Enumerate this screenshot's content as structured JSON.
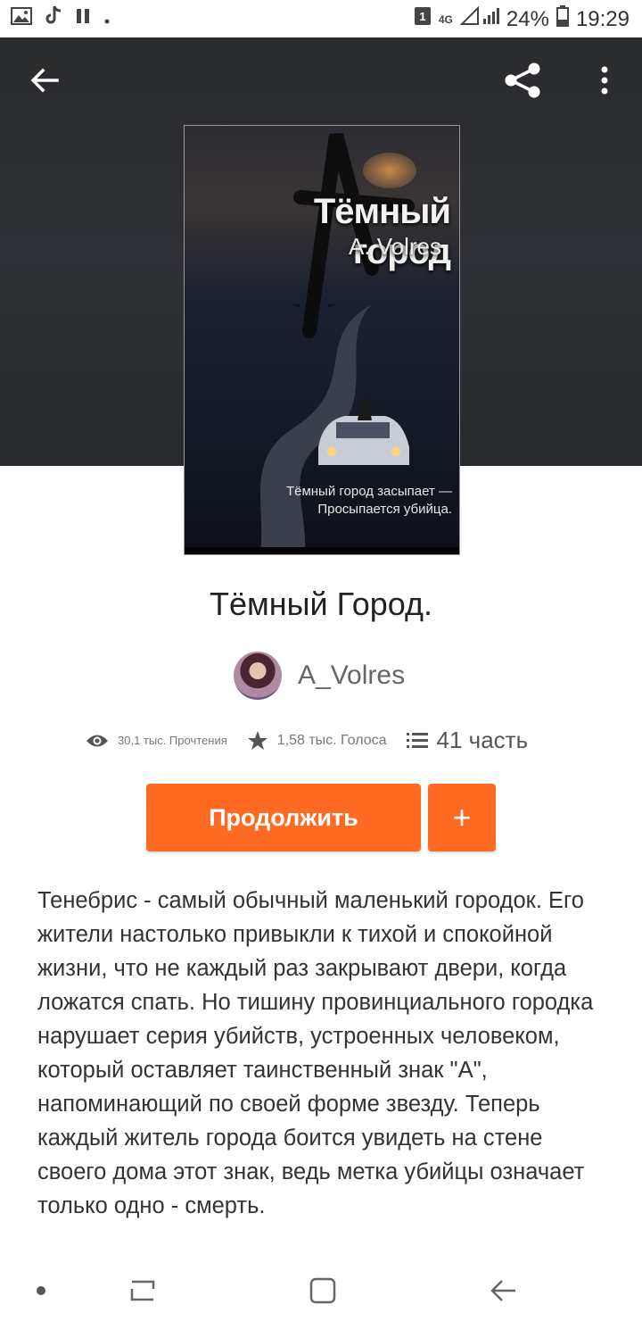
{
  "status_bar": {
    "badge": "1",
    "network": "4G",
    "battery_percent": "24%",
    "time": "19:29",
    "icons": [
      "gallery-icon",
      "tiktok-icon",
      "pause-icon",
      "dot-icon",
      "sim-icon",
      "signal-icon",
      "battery-icon"
    ]
  },
  "header": {
    "back_icon": "arrow-left-icon",
    "share_icon": "share-icon",
    "more_icon": "more-vertical-icon"
  },
  "cover": {
    "title": "Тёмный город",
    "author": "A. Volres",
    "tagline_line1": "Тёмный город засыпает —",
    "tagline_line2": "Просыпается убийца."
  },
  "book": {
    "title": "Тёмный Город.",
    "author": "A_Volres"
  },
  "stats": {
    "reads": "30,1 тыс. Прочтения",
    "votes": "1,58 тыс. Голоса",
    "parts": "41 часть"
  },
  "actions": {
    "continue_label": "Продолжить",
    "add_label": "+"
  },
  "description": "Тенебрис - самый обычный маленький городок. Его жители настолько привыкли к тихой и спокойной жизни, что не каждый раз закрывают двери, когда ложатся спать. Но тишину провинциального городка нарушает серия убийств, устроенных человеком, который оставляет таинственный знак \"А\", напоминающий по своей форме звезду. Теперь каждый житель города боится увидеть на стене своего дома этот знак, ведь метка убийцы означает только одно - смерть.",
  "nav": {
    "icons": [
      "dot-icon",
      "recent-apps-icon",
      "home-icon",
      "back-icon"
    ]
  },
  "colors": {
    "accent": "#ff6a22",
    "hero_bg": "#2c2e32"
  }
}
